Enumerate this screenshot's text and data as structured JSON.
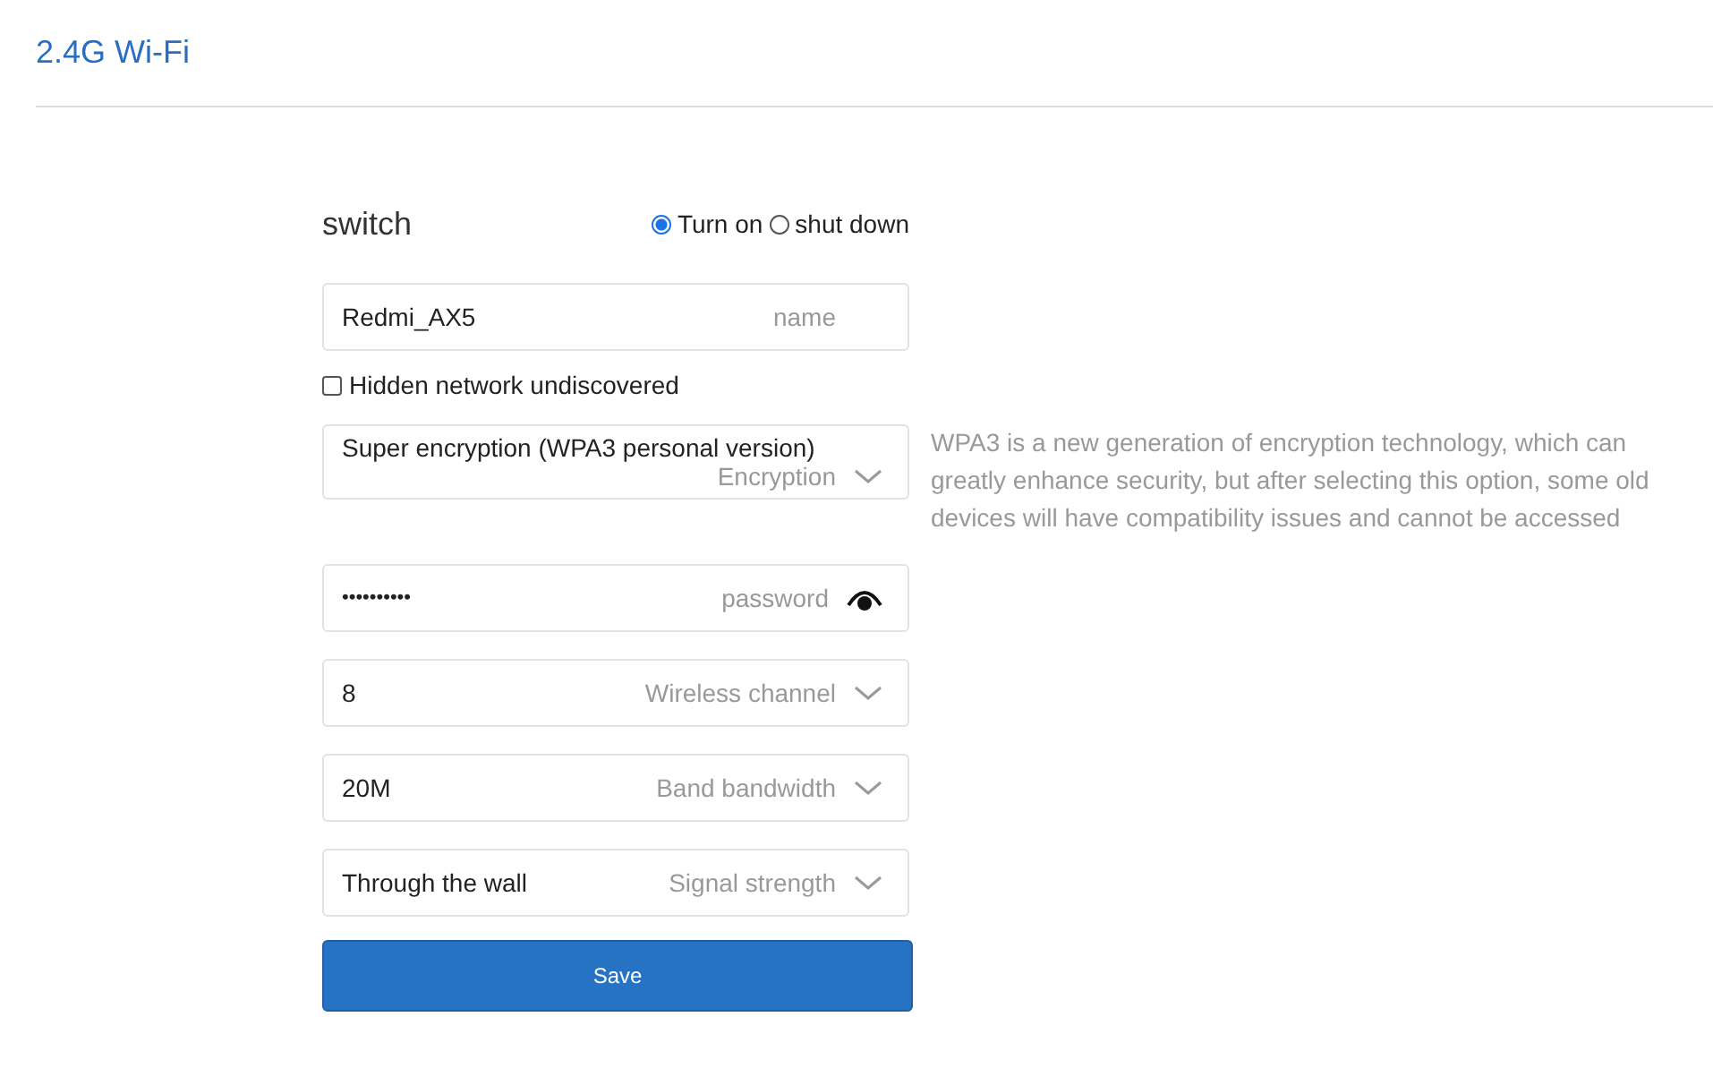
{
  "page_title": "2.4G Wi-Fi",
  "switch": {
    "label": "switch",
    "options": [
      {
        "label": "Turn on",
        "selected": true
      },
      {
        "label": "shut down",
        "selected": false
      }
    ]
  },
  "name_field": {
    "value": "Redmi_AX5",
    "label": "name"
  },
  "hidden_network": {
    "label": "Hidden network undiscovered",
    "checked": false
  },
  "fields": [
    {
      "kind": "select",
      "value": "Super encryption (WPA3 personal version)",
      "label": "Encryption",
      "help": "WPA3 is a new generation of encryption technology, which can greatly enhance security, but after selecting this option, some old devices will have compatibility issues and cannot be accessed"
    },
    {
      "kind": "password",
      "value": "••••••••••",
      "label": "password"
    },
    {
      "kind": "select",
      "value": "8",
      "label": "Wireless channel"
    },
    {
      "kind": "select",
      "value": "20M",
      "label": "Band bandwidth"
    },
    {
      "kind": "select",
      "value": "Through the wall",
      "label": "Signal strength"
    }
  ],
  "save_button": "Save"
}
